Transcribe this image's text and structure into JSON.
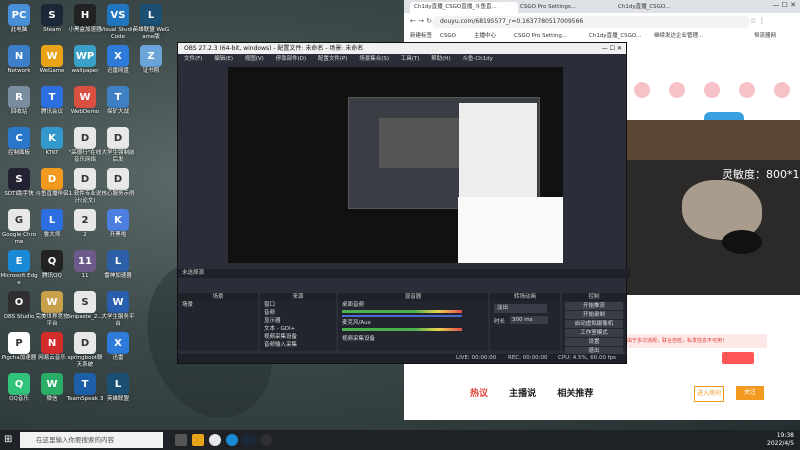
{
  "desktop": {
    "icons": [
      {
        "label": "此电脑",
        "color": "#4a90d9",
        "glyph": "PC",
        "col": 0,
        "row": 0
      },
      {
        "label": "Steam",
        "color": "#1b2838",
        "glyph": "S",
        "col": 1,
        "row": 0
      },
      {
        "label": "小黑盒加速器",
        "color": "#222",
        "glyph": "H",
        "col": 2,
        "row": 0
      },
      {
        "label": "Visual Studio Code",
        "color": "#2276c0",
        "glyph": "VS",
        "col": 3,
        "row": 0
      },
      {
        "label": "英雄联盟 WeGame版",
        "color": "#1c4f74",
        "glyph": "L",
        "col": 4,
        "row": 0
      },
      {
        "label": "Network",
        "color": "#3c7fc7",
        "glyph": "N",
        "col": 0,
        "row": 1
      },
      {
        "label": "WeGame",
        "color": "#e8a317",
        "glyph": "W",
        "col": 1,
        "row": 1
      },
      {
        "label": "wallpaper",
        "color": "#3aa0c8",
        "glyph": "WP",
        "col": 2,
        "row": 1
      },
      {
        "label": "迅雷网盘",
        "color": "#2f7bd9",
        "glyph": "X",
        "col": 3,
        "row": 1
      },
      {
        "label": "证书照",
        "color": "#6aa4d8",
        "glyph": "Z",
        "col": 4,
        "row": 1
      },
      {
        "label": "回收站",
        "color": "#7a8ea0",
        "glyph": "R",
        "col": 0,
        "row": 2
      },
      {
        "label": "腾讯会议",
        "color": "#2d6fe0",
        "glyph": "T",
        "col": 1,
        "row": 2
      },
      {
        "label": "WebDemo",
        "color": "#d95040",
        "glyph": "W",
        "col": 2,
        "row": 2
      },
      {
        "label": "探矿大战",
        "color": "#3f7fc4",
        "glyph": "T",
        "col": 3,
        "row": 2
      },
      {
        "label": "控制面板",
        "color": "#2a77c9",
        "glyph": "C",
        "col": 0,
        "row": 3
      },
      {
        "label": "KTKT",
        "color": "#3399cc",
        "glyph": "K",
        "col": 1,
        "row": 3
      },
      {
        "label": "\"高德行\"在线音乐网络",
        "color": "#e8e8e8",
        "glyph": "D",
        "col": 2,
        "row": 3
      },
      {
        "label": "大学生强制前后发",
        "color": "#e8e8e8",
        "glyph": "D",
        "col": 3,
        "row": 3
      },
      {
        "label": "SDTI助手快",
        "color": "#223",
        "glyph": "S",
        "col": 0,
        "row": 4
      },
      {
        "label": "斗鱼直播伴侣",
        "color": "#f29a1f",
        "glyph": "D",
        "col": 1,
        "row": 4
      },
      {
        "label": "1.软件专业说计(论文)",
        "color": "#e8e8e8",
        "glyph": "D",
        "col": 2,
        "row": 4
      },
      {
        "label": "核心服务示例",
        "color": "#e8e8e8",
        "glyph": "D",
        "col": 3,
        "row": 4
      },
      {
        "label": "Google Chrome",
        "color": "#e8e8e8",
        "glyph": "G",
        "col": 0,
        "row": 5
      },
      {
        "label": "鲁大师",
        "color": "#2d6fe0",
        "glyph": "L",
        "col": 1,
        "row": 5
      },
      {
        "label": "2",
        "color": "#e8e8e8",
        "glyph": "2",
        "col": 2,
        "row": 5
      },
      {
        "label": "开黑啦",
        "color": "#4c7fe0",
        "glyph": "K",
        "col": 3,
        "row": 5
      },
      {
        "label": "Microsoft Edge",
        "color": "#1b8ad6",
        "glyph": "E",
        "col": 0,
        "row": 6
      },
      {
        "label": "腾讯QQ",
        "color": "#222",
        "glyph": "Q",
        "col": 1,
        "row": 6
      },
      {
        "label": "11",
        "color": "#6b5a8a",
        "glyph": "11",
        "col": 2,
        "row": 6
      },
      {
        "label": "雷神加速器",
        "color": "#2d5fa8",
        "glyph": "L",
        "col": 3,
        "row": 6
      },
      {
        "label": "OBS Studio",
        "color": "#302e31",
        "glyph": "O",
        "col": 0,
        "row": 7
      },
      {
        "label": "完美世界竞技平台",
        "color": "#c8a24a",
        "glyph": "W",
        "col": 1,
        "row": 7
      },
      {
        "label": "Snipaste_2...",
        "color": "#e8e8e8",
        "glyph": "S",
        "col": 2,
        "row": 7
      },
      {
        "label": "大学生服务平台",
        "color": "#2a5fb0",
        "glyph": "W",
        "col": 3,
        "row": 7
      },
      {
        "label": "Pigcha加速器",
        "color": "#fff",
        "glyph": "P",
        "col": 0,
        "row": 8
      },
      {
        "label": "网易云音乐",
        "color": "#d42b2b",
        "glyph": "N",
        "col": 1,
        "row": 8
      },
      {
        "label": "springboot聊天系统",
        "color": "#e8e8e8",
        "glyph": "D",
        "col": 2,
        "row": 8
      },
      {
        "label": "迅雷",
        "color": "#2f7bd9",
        "glyph": "X",
        "col": 3,
        "row": 8
      },
      {
        "label": "QQ音乐",
        "color": "#31c27c",
        "glyph": "Q",
        "col": 0,
        "row": 9
      },
      {
        "label": "微信",
        "color": "#2aae67",
        "glyph": "W",
        "col": 1,
        "row": 9
      },
      {
        "label": "TeamSpeak 3",
        "color": "#1d5fa6",
        "glyph": "T",
        "col": 2,
        "row": 9
      },
      {
        "label": "英雄联盟",
        "color": "#1c4f74",
        "glyph": "L",
        "col": 3,
        "row": 9
      }
    ]
  },
  "taskbar": {
    "search_placeholder": "在这里输入你要搜索的内容",
    "time": "19:38",
    "date": "2022/4/5"
  },
  "browser": {
    "tabs": [
      "Ch1dy直播_CSGO直播_斗鱼直...",
      "CSGO Pro Settings...",
      "Ch1dy直播_CSGO..."
    ],
    "address": "douyu.com/68195577_r=0.1637780517009566",
    "bookmarks": [
      "新建标签",
      "CSGO",
      "主播中心",
      "CSGO Pro Setting...",
      "Ch1dy直播_CSGO...",
      "(3) Alpha_CSGO...",
      "继续发达企业管理...",
      "恒流器网"
    ],
    "live_tabs": [
      "热议",
      "主播说",
      "相关推荐"
    ],
    "sensitivity_text": "灵敏度：800*1",
    "chat_notice": "主播由于多次违规，联合自检，私发信息不可用！"
  },
  "obs": {
    "title": "OBS 27.2.3 (64-bit, windows) - 配置文件: 未命名 - 场景: 未命名",
    "menu": [
      "文件(F)",
      "编辑(E)",
      "视图(V)",
      "停靠部件(D)",
      "配置文件(P)",
      "场景集合(S)",
      "工具(T)",
      "帮助(H)",
      "斗鱼-Ch1dy"
    ],
    "source_bar_label": "未选择源",
    "docks": [
      "场景",
      "来源",
      "混音器",
      "转场动画",
      "控制"
    ],
    "scene_item": "场景",
    "sources": [
      "窗口",
      "音频",
      "显示器",
      "文本 - GDI+",
      "视频采集设备",
      "音频输入采集"
    ],
    "mixer": [
      {
        "name": "桌面音频",
        "db": "0.0 dB"
      },
      {
        "name": "麦克风/Aux",
        "db": "0.0 dB"
      },
      {
        "name": "视频采集设备",
        "db": "0.0 dB"
      }
    ],
    "transition": {
      "type": "淡出",
      "duration_label": "时长",
      "duration": "300 ms"
    },
    "controls": [
      "开始推流",
      "开始录制",
      "启动虚拟摄像机",
      "工作室模式",
      "设置",
      "退出"
    ],
    "status": {
      "live": "LIVE: 00:00:00",
      "rec": "REC: 00:00:00",
      "cpu": "CPU: 4.5%, 60.00 fps"
    }
  }
}
